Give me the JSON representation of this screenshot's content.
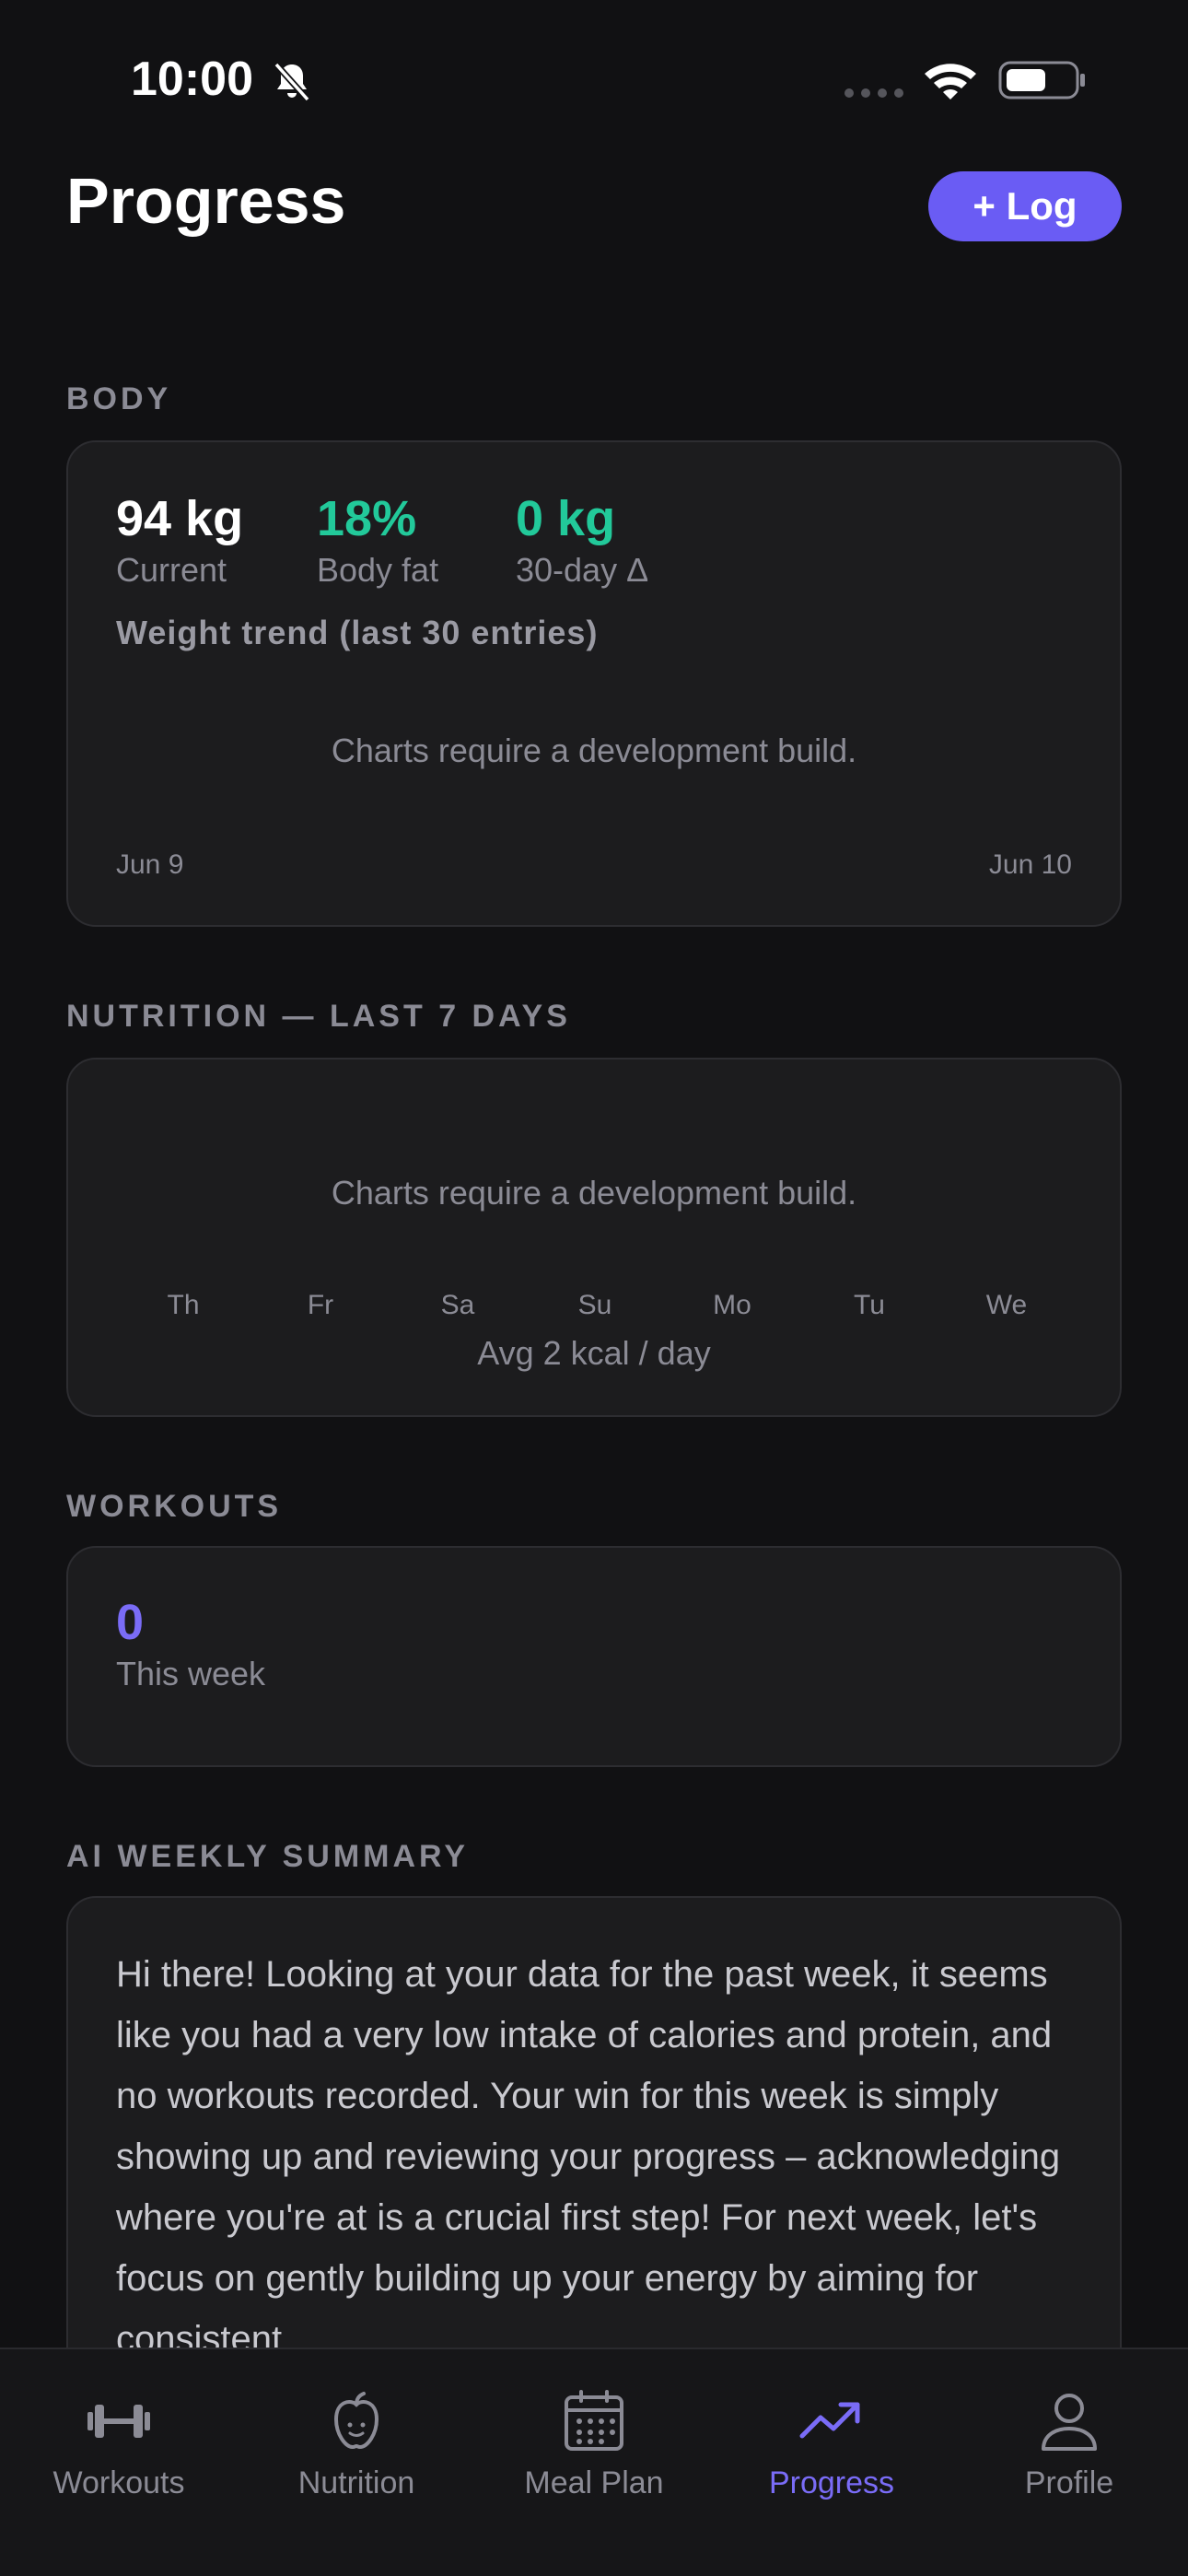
{
  "status_bar": {
    "time": "10:00"
  },
  "header": {
    "title": "Progress",
    "log_button": "+ Log"
  },
  "body_section": {
    "title": "BODY",
    "stats": [
      {
        "value": "94 kg",
        "label": "Current"
      },
      {
        "value": "18%",
        "label": "Body fat"
      },
      {
        "value": "0 kg",
        "label": "30-day Δ"
      }
    ],
    "chart_caption": "Weight trend (last 30 entries)",
    "chart_placeholder": "Charts require a development build.",
    "start_date": "Jun 9",
    "end_date": "Jun 10"
  },
  "nutrition_section": {
    "title": "NUTRITION — LAST 7 DAYS",
    "chart_placeholder": "Charts require a development build.",
    "days": [
      "Th",
      "Fr",
      "Sa",
      "Su",
      "Mo",
      "Tu",
      "We"
    ],
    "average": "Avg 2 kcal / day"
  },
  "workouts_section": {
    "title": "WORKOUTS",
    "count": "0",
    "count_label": "This week"
  },
  "summary_section": {
    "title": "AI WEEKLY SUMMARY",
    "text": "Hi there! Looking at your data for the past week, it seems like you had a very low intake of calories and protein, and no workouts recorded. Your win for this week is simply showing up and reviewing your progress – acknowledging where you're at is a crucial first step! For next week, let's focus on gently building up your energy by aiming for consistent"
  },
  "tab_bar": {
    "tabs": [
      {
        "label": "Workouts",
        "icon": "dumbbell-icon",
        "active": false
      },
      {
        "label": "Nutrition",
        "icon": "apple-icon",
        "active": false
      },
      {
        "label": "Meal Plan",
        "icon": "calendar-icon",
        "active": false
      },
      {
        "label": "Progress",
        "icon": "trending-up-icon",
        "active": true
      },
      {
        "label": "Profile",
        "icon": "person-icon",
        "active": false
      }
    ]
  },
  "colors": {
    "accent": "#6a5cf4",
    "positive": "#22c99a",
    "background": "#111113",
    "card": "#1c1c1e"
  }
}
